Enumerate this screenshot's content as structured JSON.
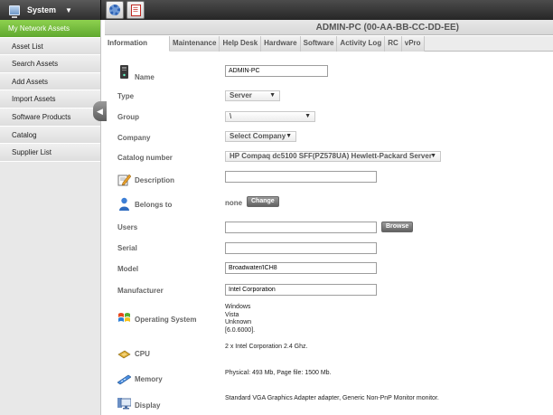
{
  "topbar": {
    "system_label": "System",
    "system_arrow": "▼",
    "icons": [
      "gear-icon",
      "pdf-icon"
    ]
  },
  "sidebar": {
    "items": [
      {
        "label": "My Network Assets",
        "active": true
      },
      {
        "label": "Asset List"
      },
      {
        "label": "Search Assets"
      },
      {
        "label": "Add Assets"
      },
      {
        "label": "Import Assets"
      },
      {
        "label": "Software Products"
      },
      {
        "label": "Catalog"
      },
      {
        "label": "Supplier List"
      }
    ],
    "collapse_glyph": "◀"
  },
  "header": {
    "title": "ADMIN-PC (00-AA-BB-CC-DD-EE)"
  },
  "tabs": [
    {
      "label": "Information",
      "active": true
    },
    {
      "label": "Maintenance"
    },
    {
      "label": "Help Desk"
    },
    {
      "label": "Hardware"
    },
    {
      "label": "Software"
    },
    {
      "label": "Activity Log"
    },
    {
      "label": "RC"
    },
    {
      "label": "vPro"
    }
  ],
  "form": {
    "name": {
      "label": "Name",
      "value": "ADMIN-PC"
    },
    "type": {
      "label": "Type",
      "value": "Server"
    },
    "group": {
      "label": "Group",
      "value": "\\"
    },
    "company": {
      "label": "Company",
      "value": "Select Company"
    },
    "catalog": {
      "label": "Catalog number",
      "value": "HP Compaq dc5100 SFF(PZ578UA) Hewlett-Packard Server"
    },
    "description": {
      "label": "Description",
      "value": ""
    },
    "belongs": {
      "label": "Belongs to",
      "value": "none",
      "button": "Change"
    },
    "users": {
      "label": "Users",
      "value": "",
      "button": "Browse"
    },
    "serial": {
      "label": "Serial",
      "value": ""
    },
    "model": {
      "label": "Model",
      "value": "Broadwater/ICH8"
    },
    "manufacturer": {
      "label": "Manufacturer",
      "value": "Intel Corporation"
    },
    "os": {
      "label": "Operating System",
      "lines": [
        "Windows",
        "Vista",
        "Unknown",
        "[6.0.6000]."
      ]
    },
    "cpu": {
      "label": "CPU",
      "value": "2 x Intel Corporation 2.4 Ghz."
    },
    "memory": {
      "label": "Memory",
      "value": "Physical: 493 Mb, Page file: 1500 Mb."
    },
    "display": {
      "label": "Display",
      "value": "Standard VGA Graphics Adapter adapter, Generic Non-PnP Monitor monitor."
    }
  },
  "colors": {
    "accent_green": "#6bb637",
    "topbar_dark": "#2e2e2e"
  }
}
